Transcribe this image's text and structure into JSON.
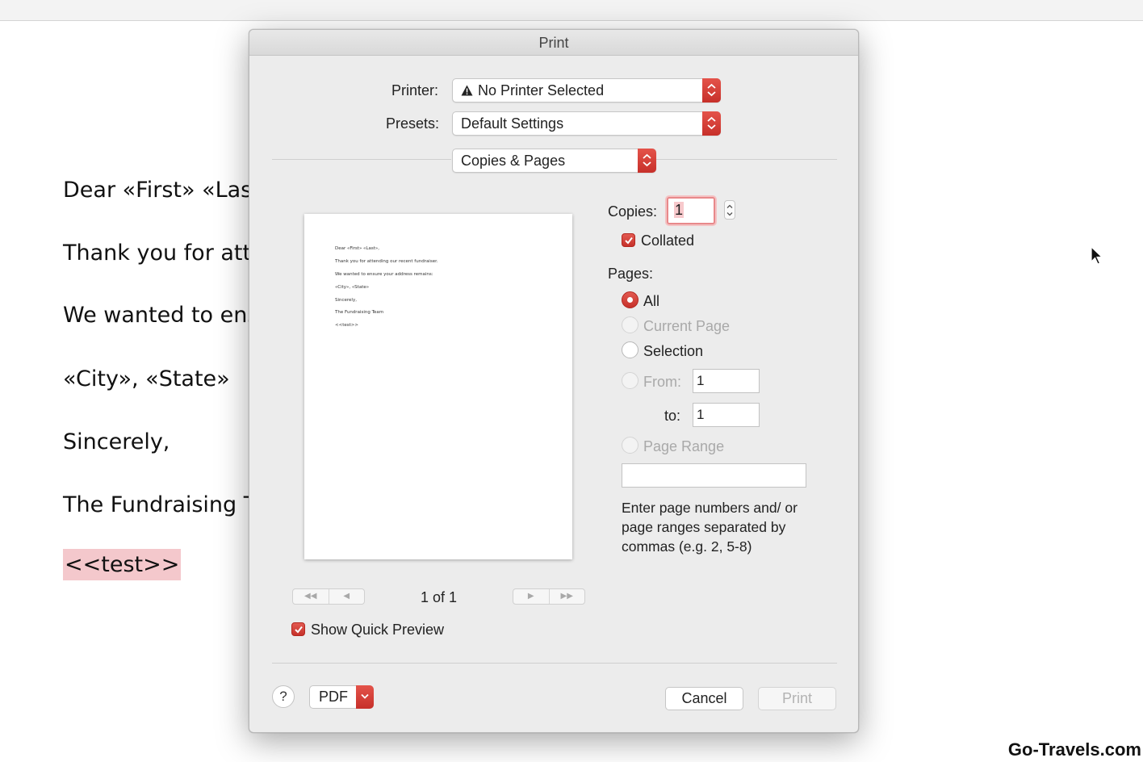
{
  "document": {
    "lines": [
      "Dear «First» «Last",
      "Thank you for atte",
      "We wanted to ens",
      "«City», «State»",
      "Sincerely,",
      "The Fundraising T"
    ],
    "highlighted_line": "<<test>>"
  },
  "watermark": "Go-Travels.com",
  "dialog": {
    "title": "Print",
    "printer": {
      "label": "Printer:",
      "value": "No Printer Selected",
      "icon": "warning-icon"
    },
    "presets": {
      "label": "Presets:",
      "value": "Default Settings"
    },
    "section": {
      "value": "Copies & Pages"
    },
    "preview": {
      "lines": [
        "Dear «First» «Last»,",
        "Thank you for attending our recent fundraiser.",
        "We wanted to ensure your address remains:",
        "«City», «State»",
        "Sincerely,",
        "The Fundraising Team",
        "<<test>>"
      ],
      "page_indicator": "1 of 1",
      "first_label": "◀◀",
      "prev_label": "◀",
      "next_label": "▶",
      "last_label": "▶▶"
    },
    "show_quick_preview": {
      "label": "Show Quick Preview",
      "checked": true
    },
    "copies": {
      "label": "Copies:",
      "value": "1"
    },
    "collated": {
      "label": "Collated",
      "checked": true
    },
    "pages": {
      "label": "Pages:",
      "options": {
        "all": "All",
        "current_page": "Current Page",
        "selection": "Selection",
        "from": "From:",
        "to": "to:",
        "page_range": "Page Range"
      },
      "selected": "All",
      "from_value": "1",
      "to_value": "1",
      "page_range_value": "",
      "help_text": "Enter page numbers and/ or page ranges separated by commas (e.g. 2, 5-8)"
    },
    "footer": {
      "help_label": "?",
      "pdf_label": "PDF",
      "cancel_label": "Cancel",
      "print_label": "Print"
    }
  },
  "colors": {
    "accent": "#d63b33",
    "dialog_bg": "#ececec",
    "highlight": "#f4c8cc"
  }
}
